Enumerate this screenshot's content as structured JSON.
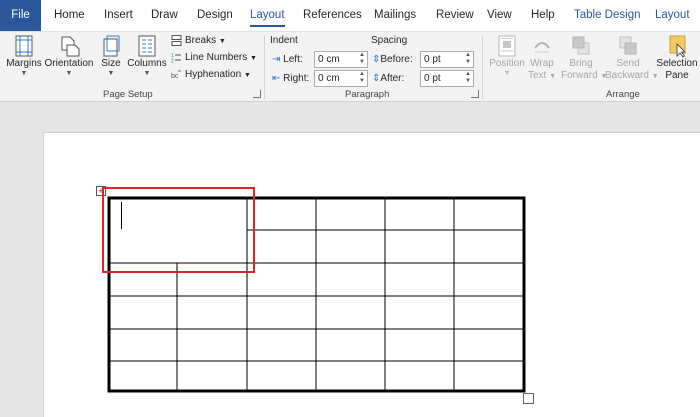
{
  "menu": {
    "file": "File",
    "home": "Home",
    "insert": "Insert",
    "draw": "Draw",
    "design": "Design",
    "layout": "Layout",
    "references": "References",
    "mailings": "Mailings",
    "review": "Review",
    "view": "View",
    "help": "Help",
    "table_design": "Table Design",
    "table_layout": "Layout",
    "accent_color": "#2b579a"
  },
  "ribbon": {
    "page_setup": {
      "label": "Page Setup",
      "margins": "Margins",
      "orientation": "Orientation",
      "size": "Size",
      "columns": "Columns",
      "breaks": "Breaks",
      "line_numbers": "Line Numbers",
      "hyphenation": "Hyphenation"
    },
    "paragraph": {
      "label": "Paragraph",
      "indent_heading": "Indent",
      "spacing_heading": "Spacing",
      "left_label": "Left:",
      "right_label": "Right:",
      "before_label": "Before:",
      "after_label": "After:",
      "left_value": "0 cm",
      "right_value": "0 cm",
      "before_value": "0 pt",
      "after_value": "0 pt"
    },
    "arrange": {
      "label": "Arrange",
      "position": "Position",
      "wrap_line1": "Wrap",
      "wrap_line2": "Text",
      "bring_line1": "Bring",
      "bring_line2": "Forward",
      "send_line1": "Send",
      "send_line2": "Backward",
      "selection_line1": "Selection",
      "selection_line2": "Pane"
    }
  },
  "document": {
    "table": {
      "rows": 6,
      "columns": 6,
      "merged_first_cell": "2 columns × 2 rows"
    },
    "highlight_color": "#d9262a"
  }
}
